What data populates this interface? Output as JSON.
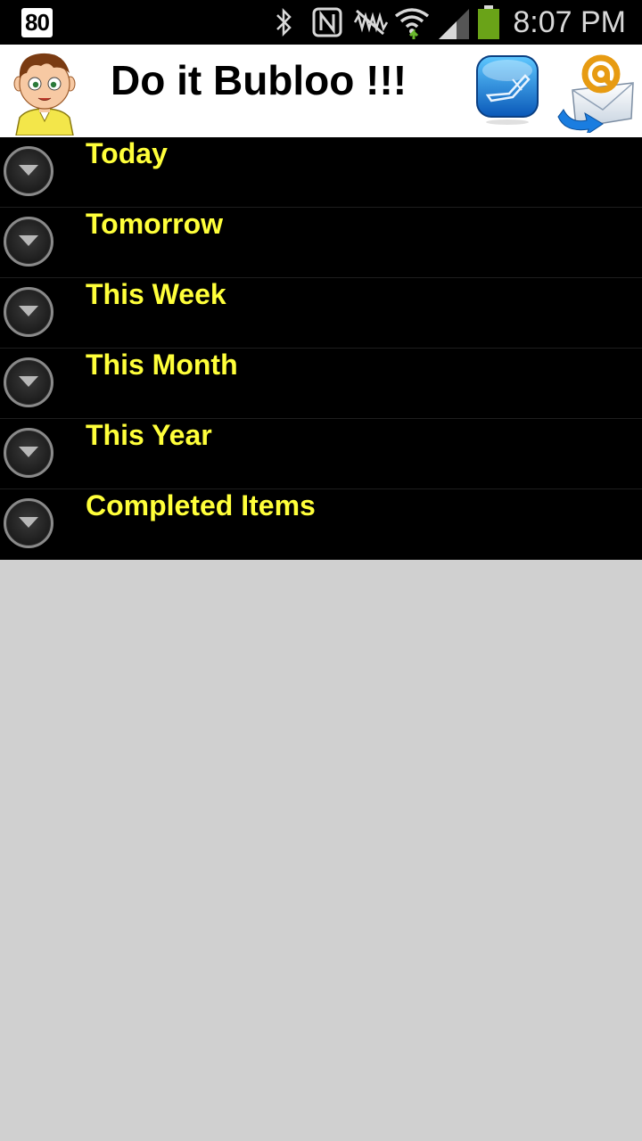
{
  "status_bar": {
    "badge": "80",
    "time": "8:07 PM",
    "icons": [
      "bluetooth-icon",
      "nfc-icon",
      "vibrate-off-icon",
      "wifi-icon",
      "signal-icon",
      "battery-icon"
    ]
  },
  "header": {
    "title": "Do it Bubloo !!!",
    "avatar_icon": "boy-avatar-icon",
    "actions": [
      "note-icon",
      "email-icon"
    ]
  },
  "list": {
    "items": [
      {
        "label": "Today"
      },
      {
        "label": "Tomorrow"
      },
      {
        "label": "This Week"
      },
      {
        "label": "This Month"
      },
      {
        "label": "This Year"
      },
      {
        "label": "Completed Items"
      }
    ]
  },
  "colors": {
    "item_text": "#ffff3a",
    "list_background": "#000000",
    "page_background": "#d0d0d0"
  }
}
